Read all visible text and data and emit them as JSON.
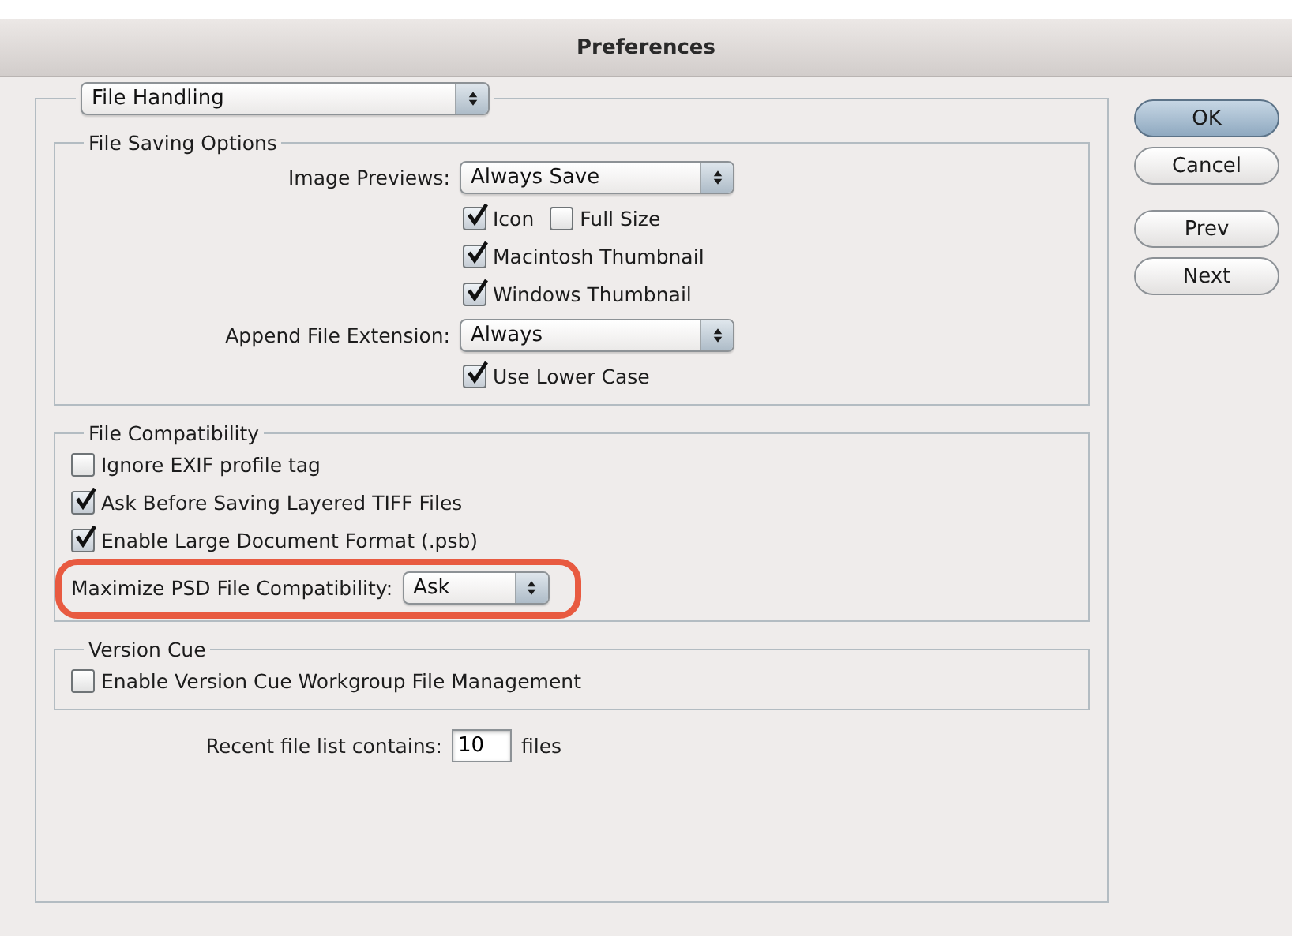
{
  "window": {
    "title": "Preferences"
  },
  "section_popup": {
    "value": "File Handling"
  },
  "groups": [
    {
      "title": "File Saving Options",
      "kind": "form",
      "rows": [
        {
          "kind": "popup",
          "label": "Image Previews:",
          "value": "Always Save"
        },
        {
          "kind": "checkboxes",
          "items": [
            {
              "label": "Icon",
              "checked": true
            },
            {
              "label": "Full Size",
              "checked": false
            }
          ]
        },
        {
          "kind": "checkboxes",
          "items": [
            {
              "label": "Macintosh Thumbnail",
              "checked": true
            }
          ]
        },
        {
          "kind": "checkboxes",
          "items": [
            {
              "label": "Windows Thumbnail",
              "checked": true
            }
          ]
        },
        {
          "kind": "popup",
          "label": "Append File Extension:",
          "value": "Always"
        },
        {
          "kind": "checkboxes",
          "items": [
            {
              "label": "Use Lower Case",
              "checked": true
            }
          ]
        }
      ]
    },
    {
      "title": "File Compatibility",
      "kind": "list",
      "rows": [
        {
          "kind": "checkboxes",
          "items": [
            {
              "label": "Ignore EXIF profile tag",
              "checked": false
            }
          ]
        },
        {
          "kind": "checkboxes",
          "items": [
            {
              "label": "Ask Before Saving Layered TIFF Files",
              "checked": true
            }
          ]
        },
        {
          "kind": "checkboxes",
          "items": [
            {
              "label": "Enable Large Document Format (.psb)",
              "checked": true
            }
          ]
        },
        {
          "kind": "popup",
          "label": "Maximize PSD File Compatibility:",
          "value": "Ask",
          "highlighted": true
        }
      ]
    },
    {
      "title": "Version Cue",
      "kind": "list",
      "rows": [
        {
          "kind": "checkboxes",
          "items": [
            {
              "label": "Enable Version Cue Workgroup File Management",
              "checked": false
            }
          ]
        }
      ]
    }
  ],
  "recent_files": {
    "label": "Recent file list contains:",
    "value": "10",
    "unit": "files"
  },
  "buttons": [
    {
      "label": "OK",
      "default": true
    },
    {
      "label": "Cancel",
      "default": false
    },
    {
      "label": "Prev",
      "default": false
    },
    {
      "label": "Next",
      "default": false
    }
  ]
}
